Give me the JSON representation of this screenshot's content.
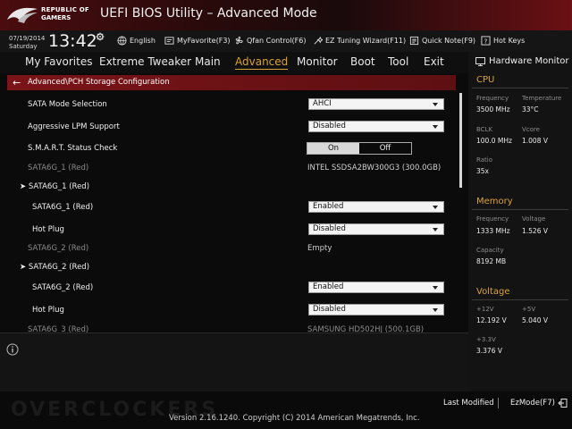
{
  "brand": {
    "line1": "REPUBLIC OF",
    "line2": "GAMERS"
  },
  "app_title": "UEFI BIOS Utility – Advanced Mode",
  "datetime": {
    "date": "07/19/2014",
    "day": "Saturday",
    "time": "13:42"
  },
  "toolbar": [
    {
      "label": "English",
      "icon": "globe-icon"
    },
    {
      "label": "MyFavorite(F3)",
      "icon": "favorite-icon"
    },
    {
      "label": "Qfan Control(F6)",
      "icon": "fan-icon"
    },
    {
      "label": "EZ Tuning Wizard(F11)",
      "icon": "wizard-icon"
    },
    {
      "label": "Quick Note(F9)",
      "icon": "note-icon"
    },
    {
      "label": "Hot Keys",
      "icon": "help-icon"
    }
  ],
  "tabs": [
    {
      "label": "My Favorites"
    },
    {
      "label": "Extreme Tweaker"
    },
    {
      "label": "Main"
    },
    {
      "label": "Advanced",
      "active": true
    },
    {
      "label": "Monitor"
    },
    {
      "label": "Boot"
    },
    {
      "label": "Tool"
    },
    {
      "label": "Exit"
    }
  ],
  "breadcrumb": "Advanced\\PCH Storage Configuration",
  "settings": [
    {
      "label": "SATA Mode Selection",
      "type": "select",
      "value": "AHCI"
    },
    {
      "label": "Aggressive LPM Support",
      "type": "select",
      "value": "Disabled"
    },
    {
      "label": "S.M.A.R.T. Status Check",
      "type": "toggle",
      "on": "On",
      "off": "Off",
      "selected": "On"
    },
    {
      "label": "SATA6G_1 (Red)",
      "type": "info",
      "value": "INTEL SSDSA2BW300G3 (300.0GB)"
    },
    {
      "label": "SATA6G_1 (Red)",
      "type": "submenu"
    },
    {
      "label": "SATA6G_1 (Red)",
      "type": "select",
      "value": "Enabled"
    },
    {
      "label": "Hot Plug",
      "type": "select",
      "value": "Disabled"
    },
    {
      "label": "SATA6G_2 (Red)",
      "type": "info",
      "value": "Empty"
    },
    {
      "label": "SATA6G_2 (Red)",
      "type": "submenu"
    },
    {
      "label": "SATA6G_2 (Red)",
      "type": "select",
      "value": "Enabled"
    },
    {
      "label": "Hot Plug",
      "type": "select",
      "value": "Disabled"
    }
  ],
  "partial_row": {
    "label": "SATA6G_3 (Red)",
    "value": "SAMSUNG HD502HJ (500.1GB)"
  },
  "hardware_monitor": {
    "title": "Hardware Monitor",
    "cpu": {
      "heading": "CPU",
      "frequency_label": "Frequency",
      "frequency": "3500 MHz",
      "temperature_label": "Temperature",
      "temperature": "33°C",
      "bclk_label": "BCLK",
      "bclk": "100.0 MHz",
      "vcore_label": "Vcore",
      "vcore": "1.008 V",
      "ratio_label": "Ratio",
      "ratio": "35x"
    },
    "memory": {
      "heading": "Memory",
      "frequency_label": "Frequency",
      "frequency": "1333 MHz",
      "voltage_label": "Voltage",
      "voltage": "1.526 V",
      "capacity_label": "Capacity",
      "capacity": "8192 MB"
    },
    "voltage": {
      "heading": "Voltage",
      "v12_label": "+12V",
      "v12": "12.192 V",
      "v5_label": "+5V",
      "v5": "5.040 V",
      "v33_label": "+3.3V",
      "v33": "3.376 V"
    }
  },
  "footer": {
    "last_modified": "Last Modified",
    "ezmode": "EzMode(F7)",
    "version": "Version 2.16.1240. Copyright (C) 2014 American Megatrends, Inc.",
    "watermark": "OVERCLOCKERS"
  },
  "colors": {
    "accent": "#d9a23a",
    "brand_red": "#7a1418"
  }
}
